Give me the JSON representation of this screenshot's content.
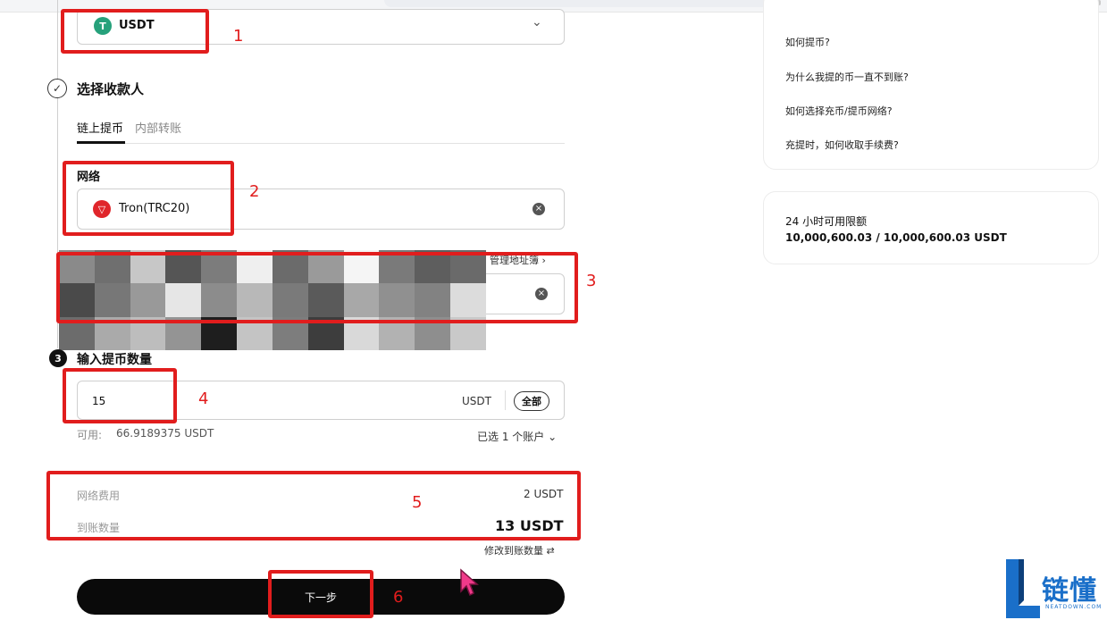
{
  "coin": {
    "symbol": "USDT",
    "icon": "tether-icon",
    "color": "#26a17b"
  },
  "recipient": {
    "heading": "选择收款人",
    "tabs": [
      "链上提币",
      "内部转账"
    ],
    "network_label": "网络",
    "network_value": "Tron(TRC20)",
    "network_icon": "tron-icon",
    "network_color": "#e0262b",
    "address_manage": "管理地址簿"
  },
  "amount": {
    "heading": "输入提币数量",
    "step": "3",
    "value": "15",
    "unit": "USDT",
    "all_label": "全部",
    "available_label": "可用:",
    "available_value": "66.9189375 USDT",
    "accounts": "已选 1 个账户"
  },
  "fees": {
    "fee_label": "网络费用",
    "fee_value": "2 USDT",
    "receive_label": "到账数量",
    "receive_value": "13 USDT",
    "modify_label": "修改到账数量"
  },
  "next_button": "下一步",
  "faq": [
    "如何提币?",
    "为什么我提的币一直不到账?",
    "如何选择充币/提币网络?",
    "充提时，如何收取手续费?"
  ],
  "limit": {
    "title": "24 小时可用限额",
    "value": "10,000,600.03 / 10,000,600.03 USDT"
  },
  "annotations": [
    "1",
    "2",
    "3",
    "4",
    "5",
    "6"
  ],
  "watermark": {
    "cn": "链懂",
    "en": "NEATDOWN.COM"
  },
  "colors": {
    "annotation_red": "#e11d1d",
    "button_black": "#0a0a0a"
  }
}
